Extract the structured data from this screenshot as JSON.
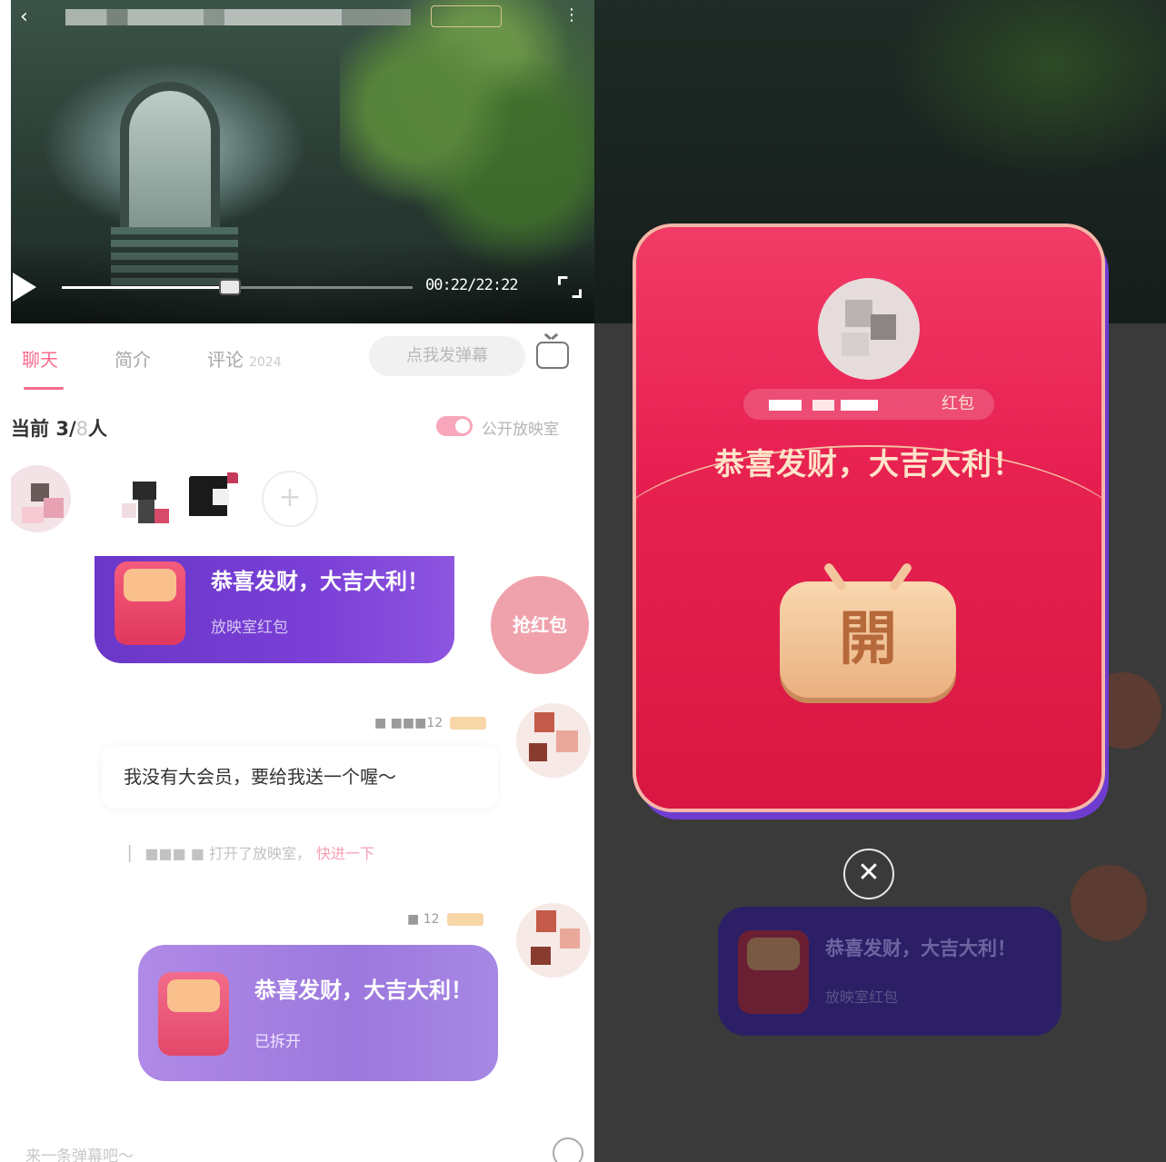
{
  "left": {
    "video": {
      "time": "00:22/22:22",
      "progress": 0.48
    },
    "tabs": [
      {
        "label": "聊天",
        "active": true
      },
      {
        "label": "简介",
        "active": false
      },
      {
        "label": "评论",
        "count": "2024",
        "active": false
      }
    ],
    "danmaku_placeholder": "点我发弹幕",
    "room": {
      "prefix": "当前",
      "current": "3",
      "sep": "/",
      "max": "8",
      "suffix": "人",
      "toggle_label": "公开放映室"
    },
    "redpacket_top": {
      "title": "恭喜发财，大吉大利！",
      "subtitle": "放映室红包",
      "grab_label": "抢红包"
    },
    "message": {
      "meta": "12",
      "text": "我没有大会员，要给我送一个喔～"
    },
    "system_note": {
      "text": "打开了放映室，",
      "link": "快进一下"
    },
    "redpacket_bottom": {
      "meta": "12",
      "title": "恭喜发财，大吉大利！",
      "subtitle": "已拆开"
    },
    "input_placeholder": "来一条弹幕吧～"
  },
  "right": {
    "envelope": {
      "sender_suffix": "红包",
      "greeting": "恭喜发财，大吉大利！",
      "open_char": "開"
    },
    "dimmed_card": {
      "title": "恭喜发财，大吉大利！",
      "subtitle": "放映室红包"
    },
    "close_symbol": "✕"
  },
  "colors": {
    "accent_pink": "#f56b8d",
    "envelope_red": "#e3174b",
    "card_purple": "#6a37c8"
  }
}
